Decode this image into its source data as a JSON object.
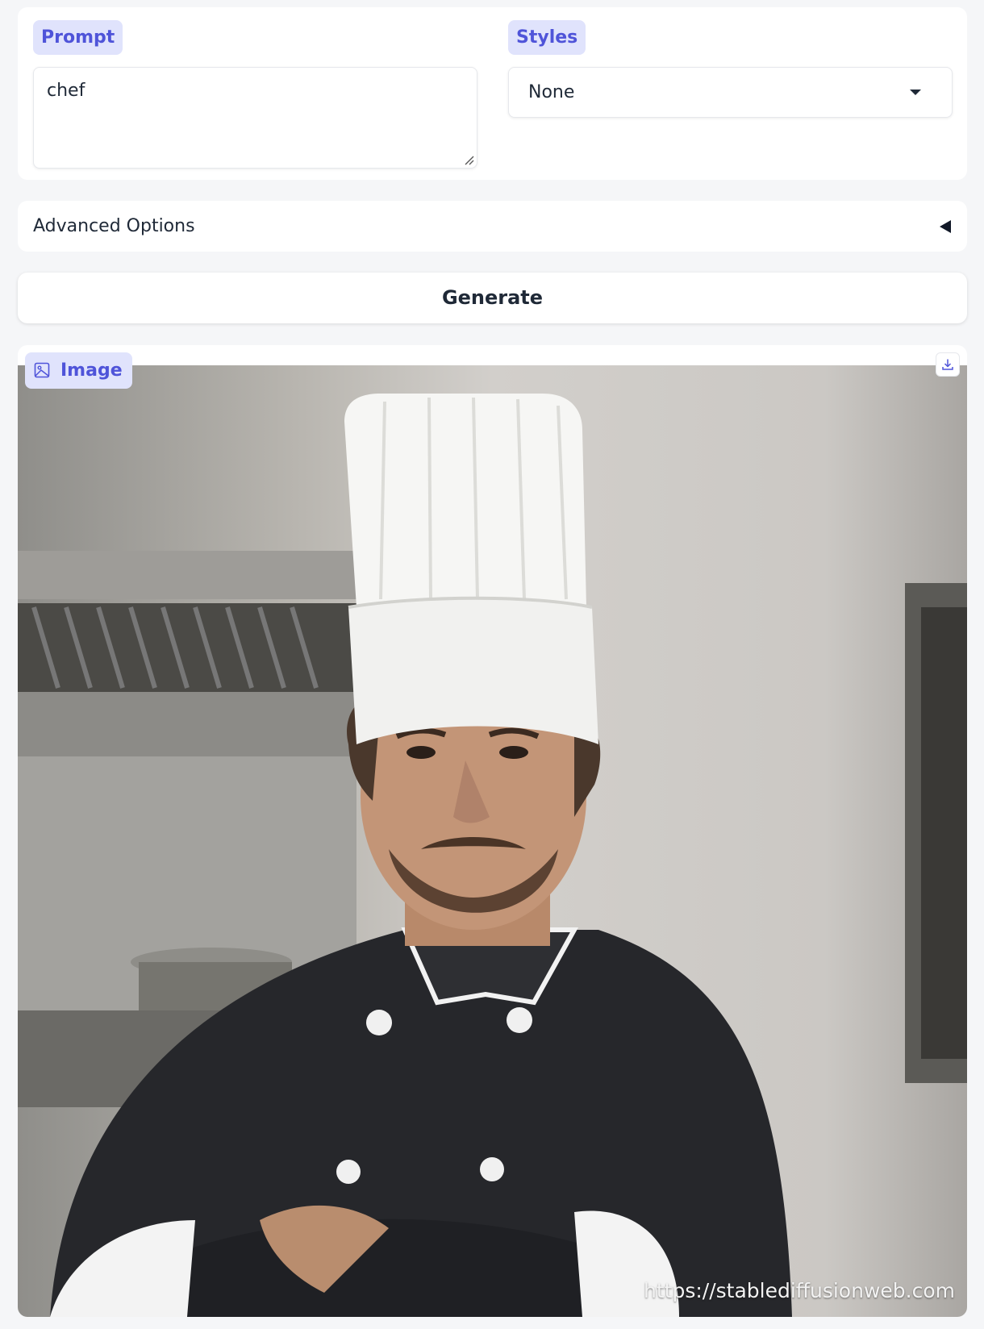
{
  "prompt": {
    "label": "Prompt",
    "value": "chef"
  },
  "styles": {
    "label": "Styles",
    "selected": "None"
  },
  "advanced": {
    "label": "Advanced Options"
  },
  "generate": {
    "label": "Generate"
  },
  "output": {
    "label": "Image",
    "watermark": "https://stablediffusionweb.com",
    "icons": [
      "image-icon",
      "download-icon"
    ]
  },
  "colors": {
    "accent_text": "#4f54d9",
    "accent_bg": "#e0e3fc"
  }
}
